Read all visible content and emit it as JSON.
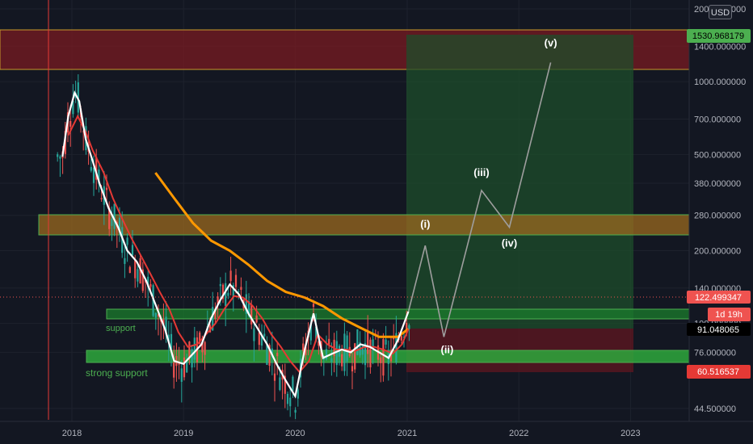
{
  "currency": "USD",
  "y_ticks": [
    "2000.000000",
    "1400.000000",
    "1000.000000",
    "700.000000",
    "500.000000",
    "380.000000",
    "280.000000",
    "200.000000",
    "140.000000",
    "100.000000",
    "76.000000",
    "44.500000"
  ],
  "x_ticks": [
    "2018",
    "2019",
    "2020",
    "2021",
    "2022",
    "2023"
  ],
  "price_badges": {
    "target": "1530.968179",
    "current": "122.499347",
    "countdown": "1d 19h",
    "entry": "91.048065",
    "stop": "60.516537"
  },
  "zones": {
    "support_label": "support",
    "strong_support_label": "strong support"
  },
  "wave_labels": [
    "(i)",
    "(ii)",
    "(iii)",
    "(iv)",
    "(v)"
  ],
  "colors": {
    "background": "#131722",
    "resistance_zone": "#7a1b22",
    "mid_zone": "#9b6a1f",
    "support_zone": "#1b7d2c",
    "strong_support_zone": "#2ea83c",
    "profit_zone": "#1e4d2b",
    "loss_zone": "#5b1720",
    "ema_fast": "#ffffff",
    "ema_mid": "#e53935",
    "ema_slow": "#ff9800",
    "up_candle": "#26a69a",
    "down_candle": "#ef5350"
  },
  "chart_data": {
    "type": "candlestick",
    "title": "",
    "y_scale": "log",
    "ylim": [
      38,
      2000
    ],
    "xlim": [
      "2017-08",
      "2023-07"
    ],
    "x_tick_labels": [
      "2018",
      "2019",
      "2020",
      "2021",
      "2022",
      "2023"
    ],
    "y_tick_labels": [
      2000,
      1400,
      1000,
      700,
      500,
      380,
      280,
      200,
      140,
      100,
      76,
      44.5
    ],
    "series": [
      {
        "name": "",
        "kind": "moving_average_white",
        "x": [
          "2017-12-01",
          "2017-12-20",
          "2018-01-10",
          "2018-01-25",
          "2018-02-15",
          "2018-03-10",
          "2018-04-01",
          "2018-05-01",
          "2018-06-01",
          "2018-07-01",
          "2018-08-01",
          "2018-09-01",
          "2018-10-01",
          "2018-11-01",
          "2018-12-01",
          "2019-01-01",
          "2019-02-01",
          "2019-03-01",
          "2019-04-01",
          "2019-05-01",
          "2019-06-01",
          "2019-07-01",
          "2019-08-01",
          "2019-09-01",
          "2019-10-01",
          "2019-11-01",
          "2019-12-01",
          "2020-01-01",
          "2020-02-01",
          "2020-03-01",
          "2020-04-01",
          "2020-05-01",
          "2020-06-01",
          "2020-07-01",
          "2020-08-01",
          "2020-09-01",
          "2020-10-01",
          "2020-11-01",
          "2020-12-01",
          "2021-01-05"
        ],
        "y": [
          490,
          720,
          900,
          830,
          580,
          470,
          380,
          300,
          250,
          200,
          180,
          150,
          120,
          95,
          70,
          68,
          75,
          82,
          105,
          125,
          145,
          132,
          110,
          95,
          82,
          68,
          58,
          50,
          78,
          110,
          72,
          75,
          78,
          76,
          82,
          80,
          76,
          72,
          85,
          112
        ]
      },
      {
        "name": "",
        "kind": "moving_average_red",
        "x": [
          "2017-12-20",
          "2018-01-20",
          "2018-02-15",
          "2018-03-10",
          "2018-04-15",
          "2018-05-15",
          "2018-06-15",
          "2018-07-15",
          "2018-08-15",
          "2018-09-15",
          "2018-10-15",
          "2018-11-15",
          "2018-12-15",
          "2019-01-15",
          "2019-02-15",
          "2019-03-15",
          "2019-04-15",
          "2019-05-15",
          "2019-06-15",
          "2019-07-15",
          "2019-08-15",
          "2019-09-15",
          "2019-10-15",
          "2019-11-15",
          "2019-12-15",
          "2020-01-15",
          "2020-02-15",
          "2020-03-15",
          "2020-04-15",
          "2020-05-15",
          "2020-06-15",
          "2020-07-15",
          "2020-08-15",
          "2020-09-15",
          "2020-10-15",
          "2020-11-15",
          "2020-12-15",
          "2021-01-05"
        ],
        "y": [
          600,
          720,
          620,
          520,
          420,
          330,
          270,
          225,
          190,
          160,
          135,
          115,
          92,
          80,
          82,
          90,
          100,
          115,
          130,
          128,
          118,
          105,
          90,
          80,
          70,
          63,
          70,
          90,
          82,
          78,
          78,
          77,
          80,
          80,
          78,
          75,
          82,
          95
        ]
      },
      {
        "name": "",
        "kind": "moving_average_orange",
        "x": [
          "2018-10-01",
          "2018-12-01",
          "2019-02-01",
          "2019-04-01",
          "2019-06-01",
          "2019-08-01",
          "2019-10-01",
          "2019-12-01",
          "2020-02-01",
          "2020-04-01",
          "2020-06-01",
          "2020-08-01",
          "2020-10-01",
          "2020-12-01",
          "2021-01-05"
        ],
        "y": [
          420,
          330,
          260,
          220,
          200,
          175,
          150,
          135,
          128,
          118,
          105,
          96,
          88,
          88,
          95
        ]
      },
      {
        "name": "",
        "kind": "elliott_wave_projection",
        "x": [
          "2021-01-05",
          "2021-03-01",
          "2021-05-01",
          "2021-09-01",
          "2021-12-01",
          "2022-04-15"
        ],
        "y": [
          112,
          210,
          88,
          355,
          250,
          1200
        ],
        "labels": [
          "",
          "(i)",
          "(ii)",
          "(iii)",
          "(iv)",
          "(v)"
        ]
      }
    ],
    "zones": [
      {
        "label": "",
        "y": [
          1090,
          1650
        ],
        "x": [
          "2017-08",
          "2023-07"
        ]
      },
      {
        "label": "",
        "y": [
          230,
          275
        ],
        "x": [
          "2017-08",
          "2023-07"
        ]
      },
      {
        "label": "support",
        "y": [
          103,
          110
        ],
        "x": [
          "2018-04",
          "2023-07"
        ]
      },
      {
        "label": "strong support",
        "y": [
          67,
          72
        ],
        "x": [
          "2018-02",
          "2023-07"
        ]
      },
      {
        "label": "",
        "y": [
          91.048065,
          1530.968179
        ],
        "x": [
          "2021-01",
          "2022-10"
        ]
      },
      {
        "label": "",
        "y": [
          60.516537,
          91.048065
        ],
        "x": [
          "2021-01",
          "2022-10"
        ]
      }
    ],
    "price_lines": [
      {
        "label": "1530.968179",
        "value": 1530.968179
      },
      {
        "label": "122.499347",
        "value": 122.499347
      },
      {
        "label": "91.048065",
        "value": 91.048065
      },
      {
        "label": "60.516537",
        "value": 60.516537
      }
    ],
    "grid": true,
    "legend": "none"
  }
}
